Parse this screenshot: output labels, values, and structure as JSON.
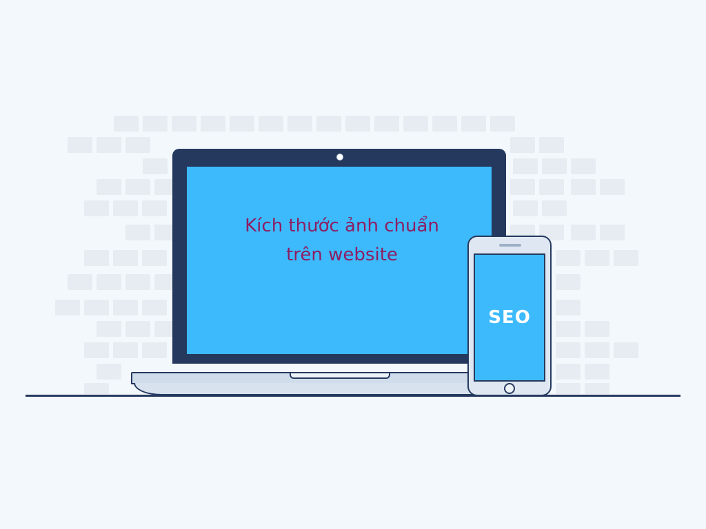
{
  "laptop": {
    "screen_text_line1": "Kích thước ảnh chuẩn",
    "screen_text_line2": "trên website"
  },
  "phone": {
    "screen_text": "SEO"
  },
  "colors": {
    "background": "#f3f8fc",
    "brick": "#e6ecf1",
    "device_outline": "#25395f",
    "screen": "#3dbafc",
    "laptop_text": "#8c1f63",
    "phone_text": "#ffffff"
  },
  "icons": [
    "laptop-icon",
    "smartphone-icon",
    "brick-wall-decoration"
  ]
}
